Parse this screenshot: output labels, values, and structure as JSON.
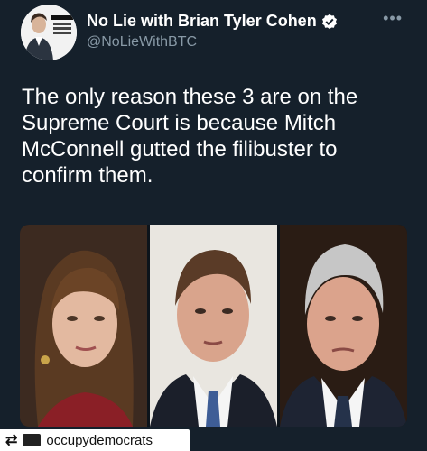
{
  "tweet": {
    "display_name": "No Lie with Brian Tyler Cohen",
    "handle": "@NoLieWithBTC",
    "more_glyph": "•••",
    "text": "The only reason these 3 are on the Supreme Court is because Mitch McConnell gutted the filibuster to confirm them.",
    "avatar_logo_text": "NO LIE with BRIAN TYLER COHEN"
  },
  "media": {
    "photos": [
      {
        "label": "left-photo"
      },
      {
        "label": "middle-photo"
      },
      {
        "label": "right-photo"
      }
    ]
  },
  "repost": {
    "icon": "repost-icon",
    "username": "occupydemocrats"
  },
  "colors": {
    "background": "#15202b",
    "secondary_text": "#8899a6",
    "verified": "#ffffff"
  }
}
